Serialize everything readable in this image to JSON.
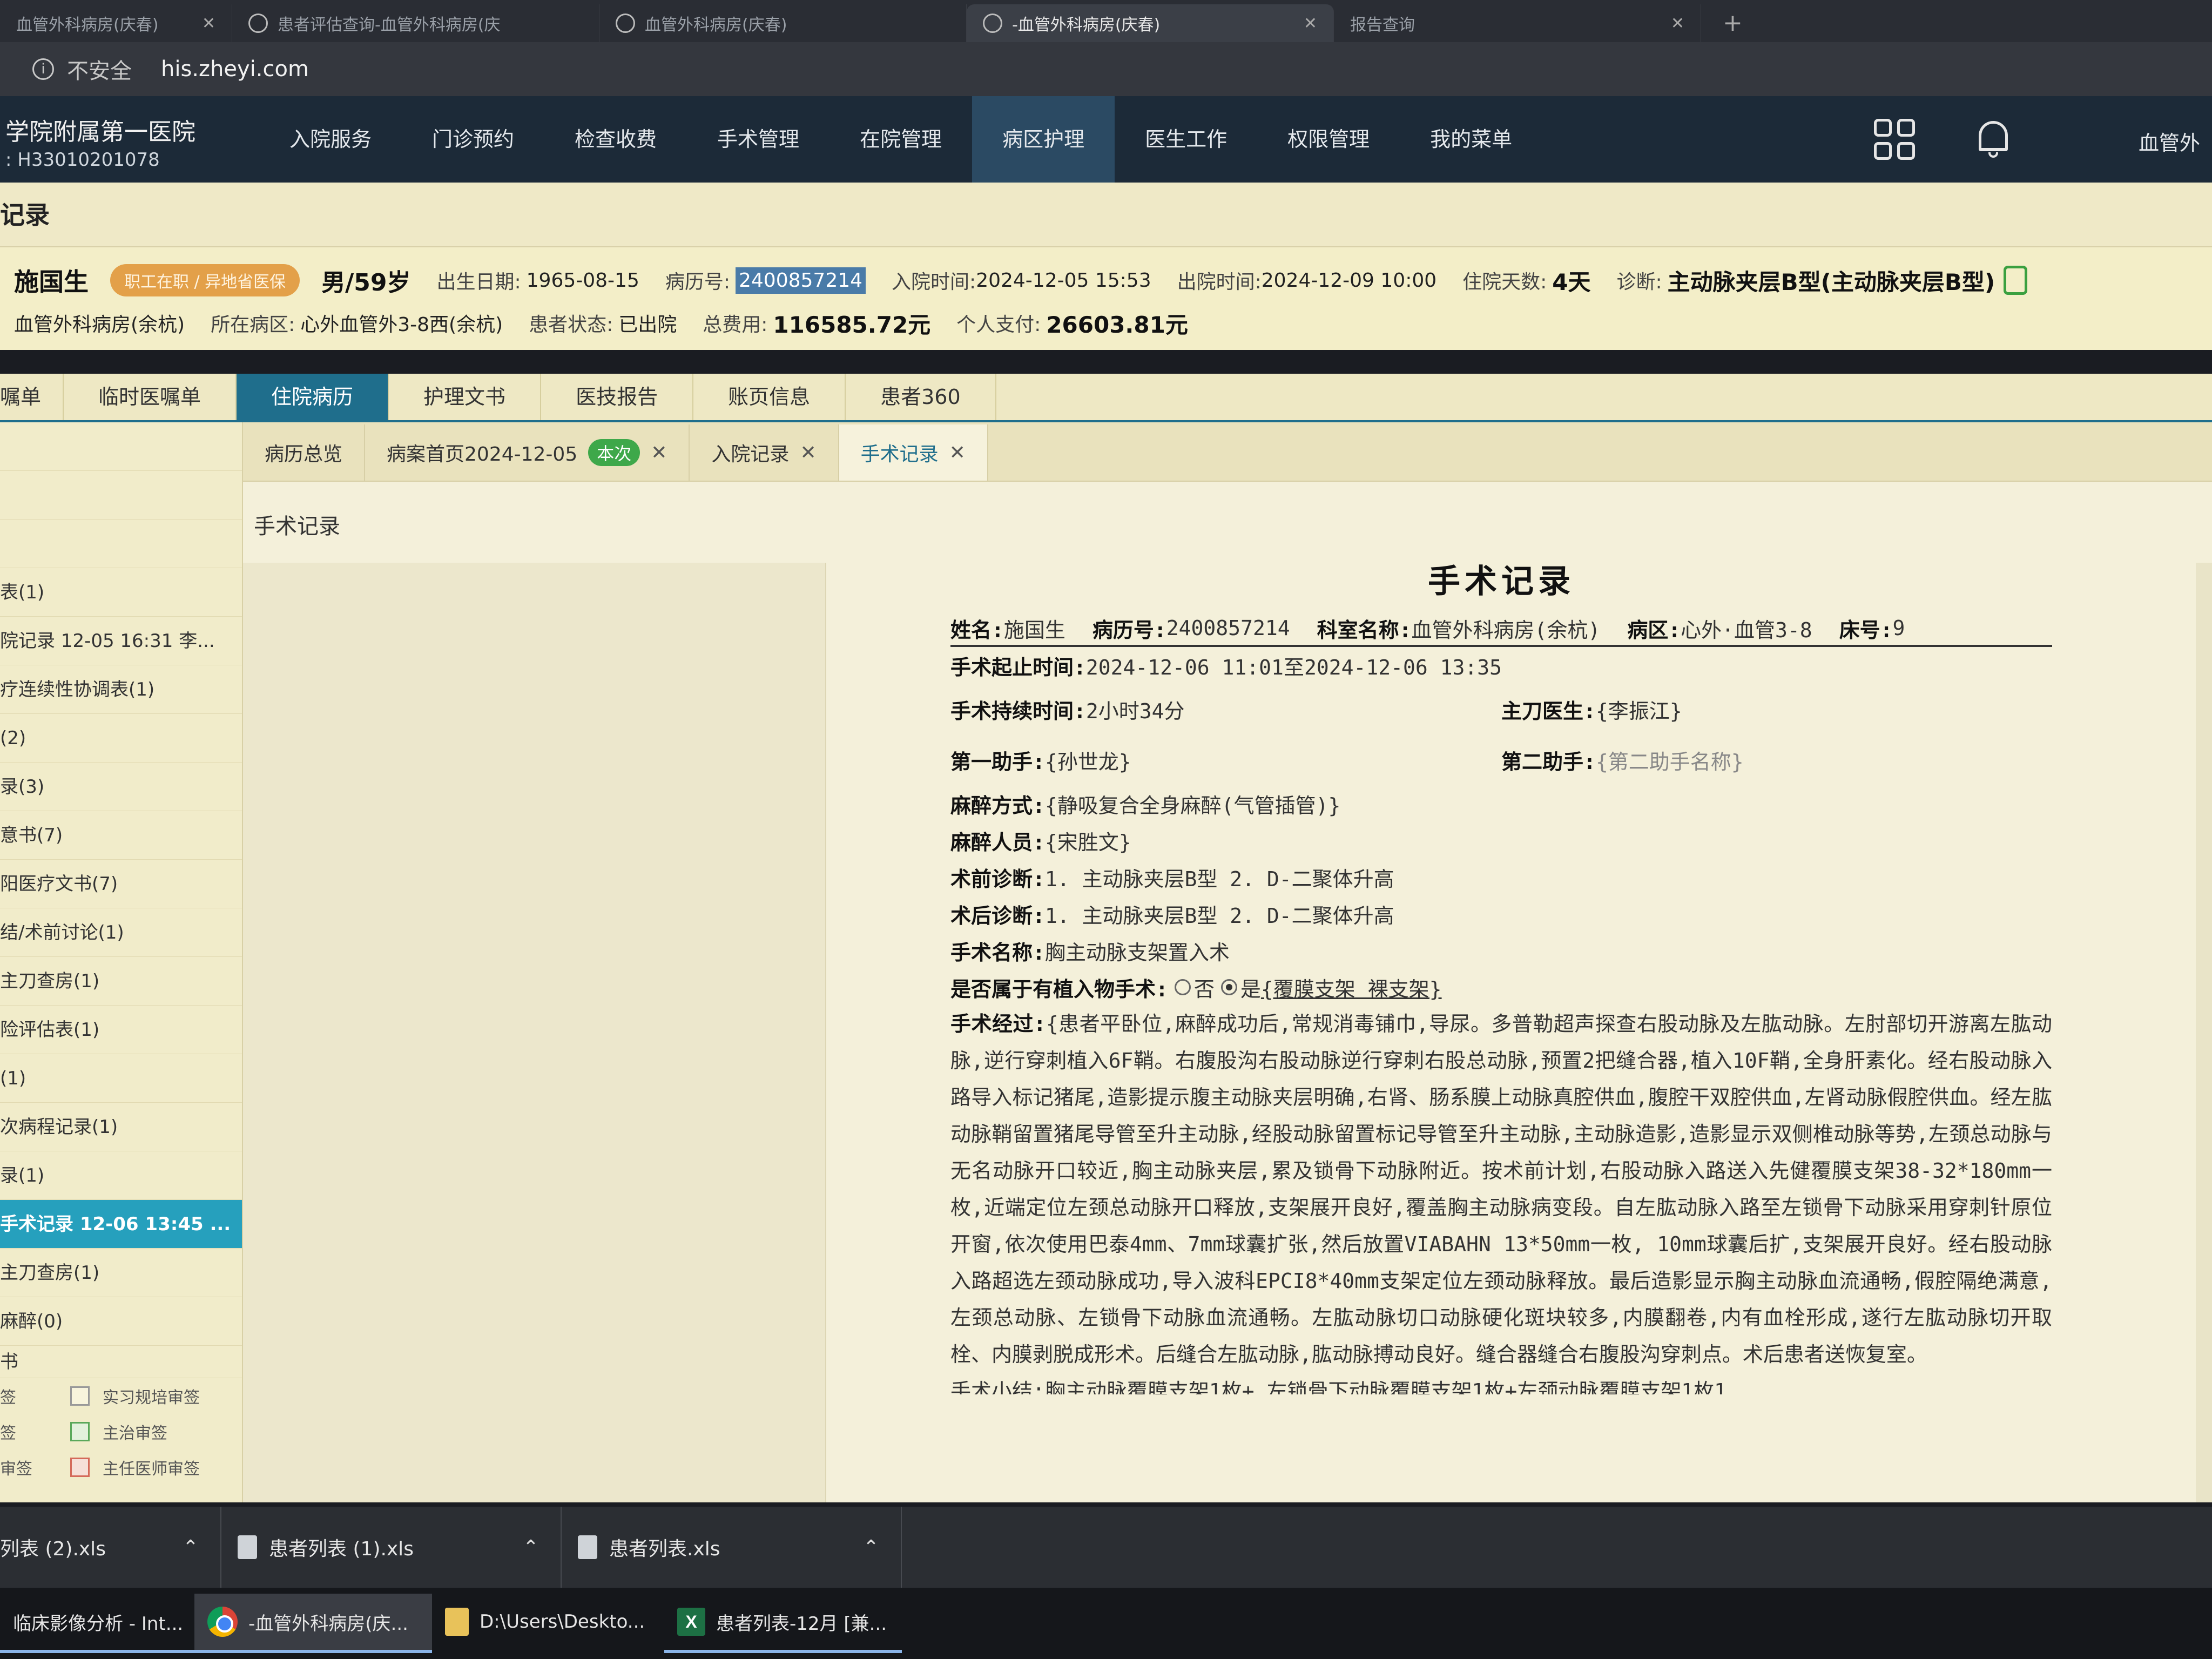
{
  "browser": {
    "tabs": [
      {
        "label": "血管外科病房(庆春)"
      },
      {
        "label": "患者评估查询-血管外科病房(庆"
      },
      {
        "label": "血管外科病房(庆春)"
      },
      {
        "label": "-血管外科病房(庆春)"
      },
      {
        "label": "报告查询"
      }
    ],
    "new_tab": "+",
    "security_label": "不安全",
    "url": "his.zheyi.com"
  },
  "header": {
    "hospital_name": "学院附属第一医院",
    "hospital_code": ": H33010201078",
    "nav": [
      "入院服务",
      "门诊预约",
      "检查收费",
      "手术管理",
      "在院管理",
      "病区护理",
      "医生工作",
      "权限管理",
      "我的菜单"
    ],
    "active_nav": "病区护理",
    "user": "血管外"
  },
  "page": {
    "title": "记录"
  },
  "patient": {
    "name": "施国生",
    "badge": "职工在职 / 异地省医保",
    "sex_age": "男/59岁",
    "dob_label": "出生日期:",
    "dob": "1965-08-15",
    "record_no_label": "病历号:",
    "record_no": "2400857214",
    "admit_label": "入院时间:",
    "admit_time": "2024-12-05 15:53",
    "discharge_label": "出院时间:",
    "discharge_time": "2024-12-09 10:00",
    "days_label": "住院天数:",
    "days": "4天",
    "diag_label": "诊断:",
    "diagnosis": "主动脉夹层B型(主动脉夹层B型)",
    "dept": "血管外科病房(余杭)",
    "ward_label": "所在病区:",
    "ward": "心外血管外3-8西(余杭)",
    "status_label": "患者状态:",
    "status": "已出院",
    "total_label": "总费用:",
    "total": "116585.72元",
    "self_label": "个人支付:",
    "self_pay": "26603.81元"
  },
  "main_tabs": [
    "嘱单",
    "临时医嘱单",
    "住院病历",
    "护理文书",
    "医技报告",
    "账页信息",
    "患者360"
  ],
  "sidebar": {
    "items": [
      "",
      "",
      "",
      "表(1)",
      "院记录 12-05 16:31 李...",
      "疗连续性协调表(1)",
      "(2)",
      "录(3)",
      "意书(7)",
      "阳医疗文书(7)",
      "结/术前讨论(1)",
      "主刀查房(1)",
      "险评估表(1)",
      "(1)",
      "次病程记录(1)",
      "录(1)",
      "手术记录 12-06 13:45 ...",
      "主刀查房(1)",
      "麻醉(0)",
      "书"
    ],
    "active_index": 16,
    "legend": [
      {
        "left": "签",
        "label": "实习规培审签"
      },
      {
        "left": "签",
        "label": "主治审签"
      },
      {
        "left": "审签",
        "label": "主任医师审签"
      }
    ]
  },
  "sub_tabs": [
    {
      "label": "病历总览",
      "closable": false
    },
    {
      "label": "病案首页2024-12-05",
      "badge": "本次",
      "closable": true
    },
    {
      "label": "入院记录",
      "closable": true
    },
    {
      "label": "手术记录",
      "closable": true
    }
  ],
  "content": {
    "section_title": "手术记录"
  },
  "record": {
    "title": "手术记录",
    "name_label": "姓名:",
    "name": "施国生",
    "record_label": "病历号:",
    "record_no": "2400857214",
    "dept_label": "科室名称:",
    "dept": "血管外科病房(余杭)",
    "ward_label": "病区:",
    "ward": "心外·血管3-8",
    "bed_label": "床号:",
    "bed": "9",
    "time_label": "手术起止时间:",
    "time": "2024-12-06 11:01至2024-12-06 13:35",
    "duration_label": "手术持续时间:",
    "duration": "2小时34分",
    "surgeon_label": "主刀医生:",
    "surgeon": "{李振江}",
    "assist1_label": "第一助手:",
    "assist1": "{孙世龙}",
    "assist2_label": "第二助手:",
    "assist2": "{第二助手名称}",
    "anes_method_label": "麻醉方式:",
    "anes_method": "{静吸复合全身麻醉(气管插管)}",
    "anes_person_label": "麻醉人员:",
    "anes_person": "{宋胜文}",
    "pre_diag_label": "术前诊断:",
    "pre_diag": "1. 主动脉夹层B型 2. D-二聚体升高",
    "post_diag_label": "术后诊断:",
    "post_diag": "1. 主动脉夹层B型 2. D-二聚体升高",
    "op_name_label": "手术名称:",
    "op_name": "胸主动脉支架置入术",
    "implant_label": "是否属于有植入物手术:",
    "implant_no": "否",
    "implant_yes": "是",
    "implant_value": "{覆膜支架 裸支架}",
    "process_label": "手术经过:",
    "process": "{患者平卧位,麻醉成功后,常规消毒铺巾,导尿。多普勒超声探查右股动脉及左肱动脉。左肘部切开游离左肱动脉,逆行穿刺植入6F鞘。右腹股沟右股动脉逆行穿刺右股总动脉,预置2把缝合器,植入10F鞘,全身肝素化。经右股动脉入路导入标记猪尾,造影提示腹主动脉夹层明确,右肾、肠系膜上动脉真腔供血,腹腔干双腔供血,左肾动脉假腔供血。经左肱动脉鞘留置猪尾导管至升主动脉,经股动脉留置标记导管至升主动脉,主动脉造影,造影显示双侧椎动脉等势,左颈总动脉与无名动脉开口较近,胸主动脉夹层,累及锁骨下动脉附近。按术前计划,右股动脉入路送入先健覆膜支架38-32*180mm一枚,近端定位左颈总动脉开口释放,支架展开良好,覆盖胸主动脉病变段。自左肱动脉入路至左锁骨下动脉采用穿刺针原位开窗,依次使用巴泰4mm、7mm球囊扩张,然后放置VIABAHN 13*50mm一枚, 10mm球囊后扩,支架展开良好。经右股动脉入路超选左颈动脉成功,导入波科EPCI8*40mm支架定位左颈动脉释放。最后造影显示胸主动脉血流通畅,假腔隔绝满意,左颈总动脉、左锁骨下动脉血流通畅。左肱动脉切口动脉硬化斑块较多,内膜翻卷,内有血栓形成,遂行左肱动脉切开取栓、内膜剥脱成形术。后缝合左肱动脉,肱动脉搏动良好。缝合器缝合右腹股沟穿刺点。术后患者送恢复室。",
    "summary_partial": "手术小结:胸主动脉覆膜支架1枚+ 左锁骨下动脉覆膜支架1枚+左颈动脉覆膜支架1枚1"
  },
  "downloads": [
    {
      "label": "列表 (2).xls"
    },
    {
      "label": "患者列表 (1).xls"
    },
    {
      "label": "患者列表.xls"
    }
  ],
  "taskbar": [
    {
      "label": "临床影像分析 - Int..."
    },
    {
      "label": "-血管外科病房(庆..."
    },
    {
      "label": "D:\\Users\\Deskto..."
    },
    {
      "label": "患者列表-12月 [兼..."
    }
  ]
}
